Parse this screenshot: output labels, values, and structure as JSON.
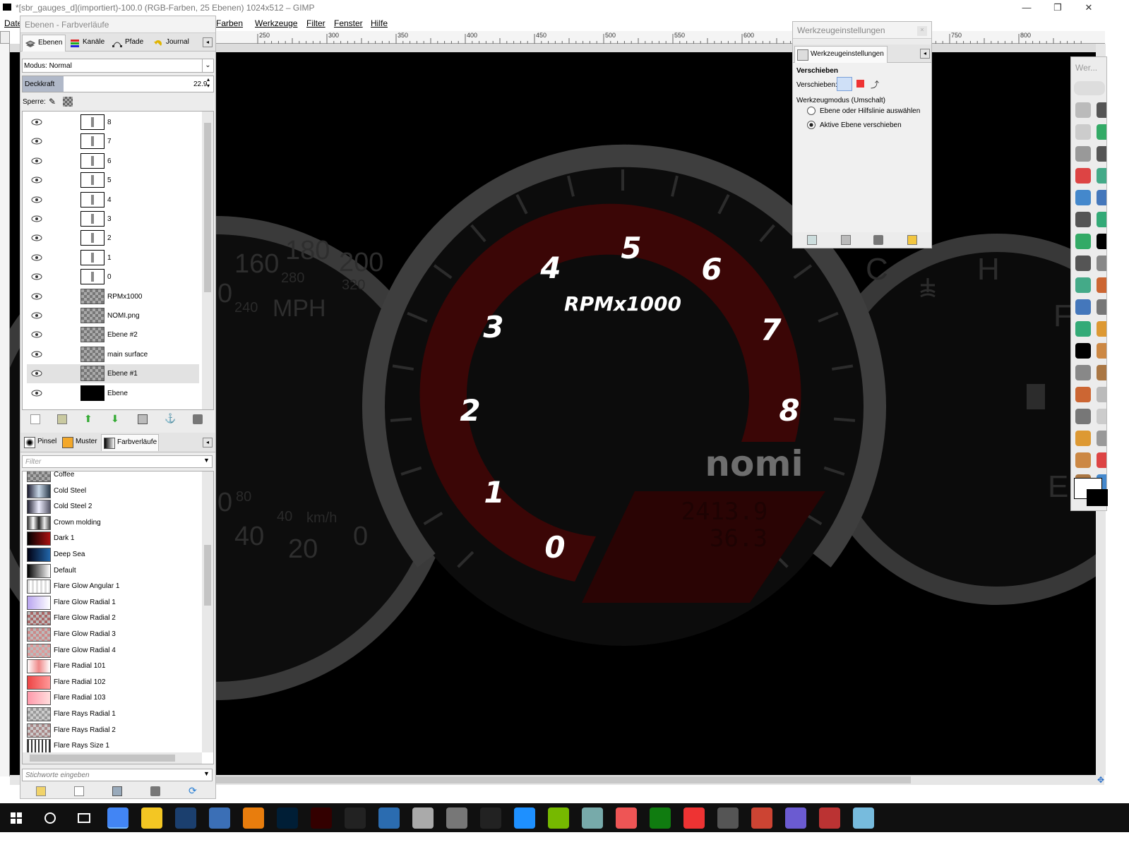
{
  "window": {
    "title": "*[sbr_gauges_d](importiert)-100.0 (RGB-Farben, 25 Ebenen) 1024x512 – GIMP",
    "minimize": "—",
    "restore": "❐",
    "close": "✕"
  },
  "menu": [
    "Datei",
    "Farben",
    "Werkzeuge",
    "Filter",
    "Fenster",
    "Hilfe"
  ],
  "menu_visible": {
    "partial": "Date"
  },
  "ruler": {
    "top": [
      "250",
      "300",
      "350",
      "400",
      "450",
      "500",
      "550",
      "600",
      "650",
      "700",
      "750",
      "800"
    ]
  },
  "layers_dock": {
    "title": "Ebenen - Farbverläufe",
    "tabs": [
      "Ebenen",
      "Kanäle",
      "Pfade",
      "Journal"
    ],
    "mode_label": "Modus: Normal",
    "opacity_label": "Deckkraft",
    "opacity_value": "22.9",
    "lock_label": "Sperre:",
    "layers": [
      "8",
      "7",
      "6",
      "5",
      "4",
      "3",
      "2",
      "1",
      "0",
      "RPMx1000",
      "NOMI.png",
      "Ebene #2",
      "main surface",
      "Ebene #1",
      "Ebene"
    ],
    "selected_layer": "Ebene #1"
  },
  "gradients_dock": {
    "tabs": [
      "Pinsel",
      "Muster",
      "Farbverläufe"
    ],
    "filter_placeholder": "Filter",
    "items": [
      "Coffee",
      "Cold Steel",
      "Cold Steel 2",
      "Crown molding",
      "Dark 1",
      "Deep Sea",
      "Default",
      "Flare Glow Angular 1",
      "Flare Glow Radial 1",
      "Flare Glow Radial 2",
      "Flare Glow Radial 3",
      "Flare Glow Radial 4",
      "Flare Radial 101",
      "Flare Radial 102",
      "Flare Radial 103",
      "Flare Rays Radial 1",
      "Flare Rays Radial 2",
      "Flare Rays Size 1"
    ],
    "tags_placeholder": "Stichworte eingeben"
  },
  "tool_options": {
    "title": "Werkzeugeinstellungen",
    "tab": "Werkzeugeinstellungen",
    "section": "Verschieben",
    "move_label": "Verschieben:",
    "mode_label": "Werkzeugmodus (Umschalt)",
    "radio1": "Ebene oder Hilfslinie auswählen",
    "radio2": "Aktive Ebene verschieben",
    "selected_radio": "Aktive Ebene verschieben"
  },
  "toolbox": {
    "title": "Wer..."
  },
  "canvas": {
    "left_gauge": {
      "numbers": [
        "160",
        "180",
        "200",
        "280",
        "320",
        "240",
        "MPH",
        "0",
        "40",
        "20",
        "0",
        "80",
        "40",
        "km/h",
        "0"
      ]
    },
    "center_gauge": {
      "numbers": [
        "0",
        "1",
        "2",
        "3",
        "4",
        "5",
        "6",
        "7",
        "8"
      ],
      "label": "RPMx1000",
      "brand": "nomi",
      "readout1": "2413.9",
      "readout2": "36.3"
    },
    "right_gauge": {
      "labels": [
        "C",
        "H",
        "F",
        "E"
      ]
    }
  },
  "colors": {
    "accent_red": "#4a0a0a",
    "gauge_ring": "#3a3a3a",
    "canvas": "#000000"
  },
  "taskbar": {
    "icons": [
      "windows-start-icon",
      "search-icon",
      "task-view-icon",
      "chrome-icon",
      "explorer-icon",
      "steam-icon",
      "app-icon",
      "blender-icon",
      "photoshop-icon",
      "illustrator-icon",
      "inkscape-icon",
      "film-icon",
      "app2-icon",
      "gimp-icon",
      "obs-icon",
      "uplay-icon",
      "nvidia-icon",
      "app3-icon",
      "app4-icon",
      "xbox-icon",
      "app5-icon",
      "app6-icon",
      "powerpoint-icon",
      "app7-icon",
      "app8-icon",
      "app9-icon"
    ]
  }
}
